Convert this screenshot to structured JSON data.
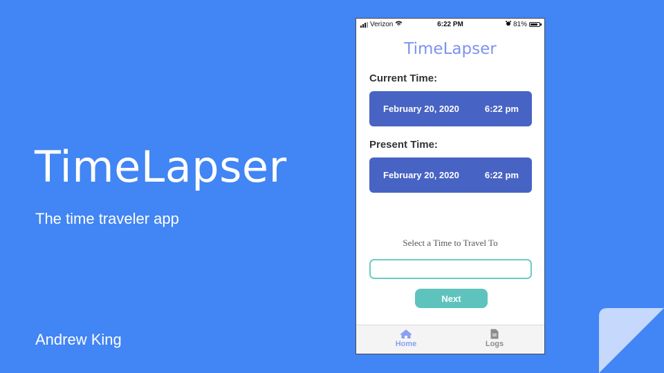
{
  "slide": {
    "title": "TimeLapser",
    "subtitle": "The time traveler app",
    "author": "Andrew King"
  },
  "phone": {
    "status_bar": {
      "carrier": "Verizon",
      "time": "6:22 PM",
      "battery": "81%",
      "battery_level": 0.81
    },
    "app_title": "TimeLapser",
    "current_time": {
      "label": "Current Time:",
      "date": "February 20, 2020",
      "time": "6:22 pm"
    },
    "present_time": {
      "label": "Present Time:",
      "date": "February 20, 2020",
      "time": "6:22 pm"
    },
    "travel": {
      "label": "Select a Time to Travel To",
      "input_value": "",
      "next_label": "Next"
    },
    "tabs": [
      {
        "label": "Home",
        "icon": "home-icon",
        "active": true
      },
      {
        "label": "Logs",
        "icon": "document-icon",
        "active": false
      }
    ]
  },
  "colors": {
    "slide_background": "#4285f4",
    "app_title": "#7a93f0",
    "time_card": "#4763c3",
    "accent_teal": "#5ec3bd",
    "tab_active": "#8aa0f3"
  }
}
